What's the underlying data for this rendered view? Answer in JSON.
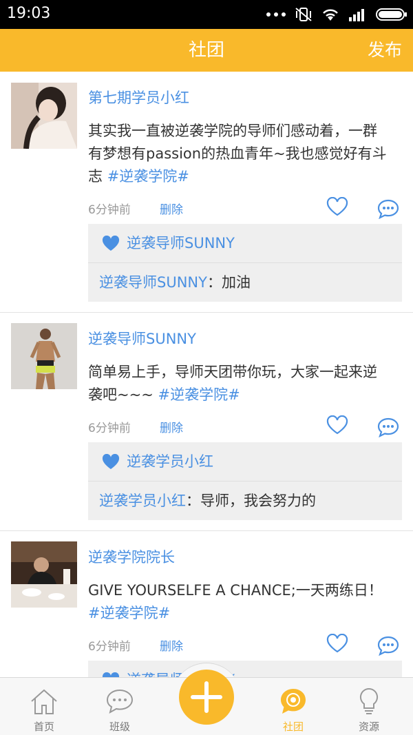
{
  "status_bar": {
    "time": "19:03"
  },
  "header": {
    "title": "社团",
    "publish_label": "发布"
  },
  "posts": [
    {
      "author": "第七期学员小红",
      "text_lines": [
        "其实我一直被逆袭学院的导师们感动着，一群",
        "有梦想有passion的热血青年~我也感觉好有斗"
      ],
      "text_last": "志 ",
      "tag": "#逆袭学院#",
      "time": "6分钟前",
      "delete_label": "删除",
      "liked_by": "逆袭导师SUNNY",
      "comment_author": "逆袭导师SUNNY",
      "comment_sep": "：",
      "comment_text": "加油"
    },
    {
      "author": "逆袭导师SUNNY",
      "text_lines": [
        "简单易上手，导师天团带你玩，大家一起来逆"
      ],
      "text_last": "袭吧~~~ ",
      "tag": "#逆袭学院#",
      "time": "6分钟前",
      "delete_label": "删除",
      "liked_by": "逆袭学员小红",
      "comment_author": "逆袭学员小红",
      "comment_sep": "：",
      "comment_text": "导师，我会努力的"
    },
    {
      "author": "逆袭学院院长",
      "text_lines": [
        "GIVE YOURSELFE A CHANCE;一天两练日！"
      ],
      "text_last": "",
      "tag": "#逆袭学院#",
      "time": "6分钟前",
      "delete_label": "删除",
      "liked_by": "逆袭导师SUNNY"
    }
  ],
  "tabbar": {
    "tabs": [
      {
        "label": "首页",
        "icon": "home-icon"
      },
      {
        "label": "班级",
        "icon": "chat-bubble-icon"
      },
      {
        "label": "社团",
        "icon": "club-icon"
      },
      {
        "label": "资源",
        "icon": "lightbulb-icon"
      }
    ],
    "active_tab": "社团",
    "fab_icon": "plus-icon"
  },
  "colors": {
    "accent": "#f9b92b",
    "link": "#4a90e2",
    "status_bar": "#000000",
    "reply_bg": "#efefef"
  }
}
